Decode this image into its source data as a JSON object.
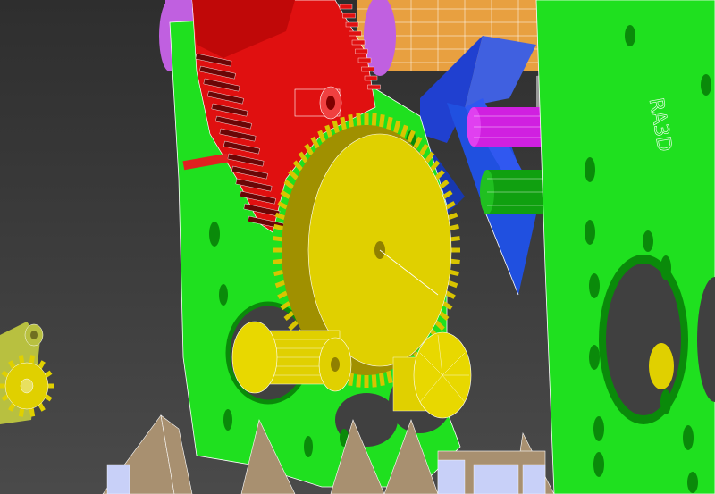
{
  "scene": {
    "plate_label": "RA3D"
  },
  "colors": {
    "background": "#3a3a3a",
    "green_plate": "#1fe01f",
    "red_rack": "#e01010",
    "yellow_gear": "#e0d000",
    "purple": "#c060e0",
    "magenta": "#d020e0",
    "blue": "#2050e0",
    "orange": "#f0a020",
    "tan_support": "#a89070",
    "olive": "#b8c040"
  }
}
